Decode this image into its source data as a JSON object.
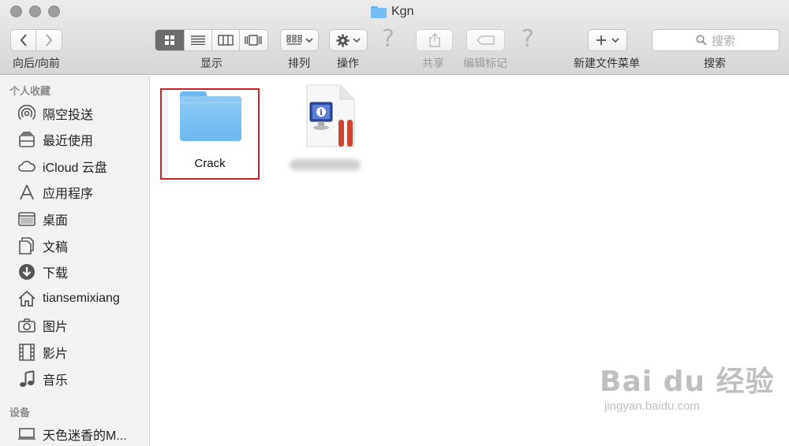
{
  "window": {
    "title": "Kgn"
  },
  "toolbar": {
    "back_forward_label": "向后/向前",
    "view_label": "显示",
    "arrange_label": "排列",
    "action_label": "操作",
    "share_label": "共享",
    "edit_tags_label": "编辑标记",
    "new_folder_menu_label": "新建文件菜单",
    "search_label": "搜索",
    "search_placeholder": "搜索"
  },
  "sidebar": {
    "favorites_header": "个人收藏",
    "favorites": [
      {
        "label": "隔空投送",
        "icon": "airdrop-icon"
      },
      {
        "label": "最近使用",
        "icon": "recents-icon"
      },
      {
        "label": "iCloud 云盘",
        "icon": "icloud-icon"
      },
      {
        "label": "应用程序",
        "icon": "applications-icon"
      },
      {
        "label": "桌面",
        "icon": "desktop-icon"
      },
      {
        "label": "文稿",
        "icon": "documents-icon"
      },
      {
        "label": "下载",
        "icon": "downloads-icon"
      },
      {
        "label": "tiansemixiang",
        "icon": "home-icon"
      },
      {
        "label": "图片",
        "icon": "pictures-icon"
      },
      {
        "label": "影片",
        "icon": "movies-icon"
      },
      {
        "label": "音乐",
        "icon": "music-icon"
      }
    ],
    "devices_header": "设备",
    "devices": [
      {
        "label": "天色迷香的M...",
        "icon": "laptop-icon"
      }
    ]
  },
  "files": [
    {
      "name": "Crack",
      "type": "folder",
      "selected": true
    },
    {
      "name": "",
      "type": "installer-package",
      "selected": false
    }
  ],
  "watermark": {
    "main": "Bai du 经验",
    "sub": "jingyan.baidu.com"
  },
  "colors": {
    "folder": "#74bdf5",
    "selection_border": "#d0202a",
    "installer_accent": "#d0442f"
  }
}
